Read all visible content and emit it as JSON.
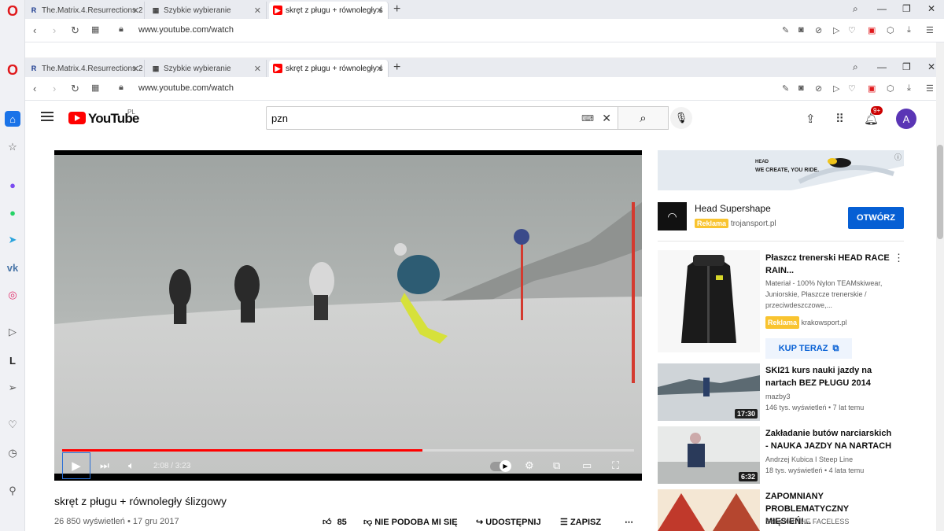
{
  "browser_top": {
    "tabs": [
      {
        "label": "The.Matrix.4.Resurrections.2",
        "favicon": "R"
      },
      {
        "label": "Szybkie wybieranie",
        "favicon": "grid"
      },
      {
        "label": "skręt z pługu + równoległy ś",
        "favicon": "youtube"
      }
    ],
    "url": "www.youtube.com/watch"
  },
  "browser": {
    "tabs": [
      {
        "label": "The.Matrix.4.Resurrections.2",
        "favicon": "R"
      },
      {
        "label": "Szybkie wybieranie",
        "favicon": "grid"
      },
      {
        "label": "skręt z pługu + równoległy ś",
        "favicon": "youtube"
      }
    ],
    "url": "www.youtube.com/watch"
  },
  "youtube": {
    "logo_text": "YouTube",
    "country": "PL",
    "search_value": "pzn",
    "notifications_badge": "9+",
    "avatar_letter": "A"
  },
  "player": {
    "time": "2:08 / 3:23",
    "progress": 0.63
  },
  "video": {
    "title": "skręt z pługu + równoległy ślizgowy",
    "meta": "26 850 wyświetleń • 17 gru 2017",
    "likes": "85",
    "dislike_label": "NIE PODOBA MI SIĘ",
    "share_label": "UDOSTĘPNIJ",
    "save_label": "ZAPISZ"
  },
  "ad": {
    "banner_line1": "HEAD",
    "banner_line2": "WE CREATE, YOU RIDE.",
    "title": "Head Supershape",
    "badge": "Reklama",
    "domain": "trojansport.pl",
    "cta": "OTWÓRZ"
  },
  "shopping_ad": {
    "title": "Płaszcz trenerski HEAD RACE RAIN...",
    "description": "Materiał - 100% Nylon TEAMskiwear, Juniorskie, Płaszcze trenerskie / przeciwdeszczowe,...",
    "badge": "Reklama",
    "domain": "krakowsport.pl",
    "cta": "KUP TERAZ"
  },
  "recommendations": [
    {
      "title": "SKI21 kurs nauki jazdy na nartach BEZ PŁUGU 2014",
      "channel": "mazby3",
      "stats": "146 tys. wyświetleń • 7 lat temu",
      "duration": "17:30"
    },
    {
      "title": "Zakładanie butów narciarskich - NAUKA JAZDY NA NARTACH",
      "channel": "Andrzej Kubica I Steep Line",
      "stats": "18 tys. wyświetleń • 4 lata temu",
      "duration": "6:32"
    },
    {
      "title": "ZAPOMNIANY PROBLEMATYCZNY MIĘSIEŃ!...",
      "channel": "Seba Kot THE FACELESS",
      "stats": "",
      "duration": ""
    }
  ]
}
